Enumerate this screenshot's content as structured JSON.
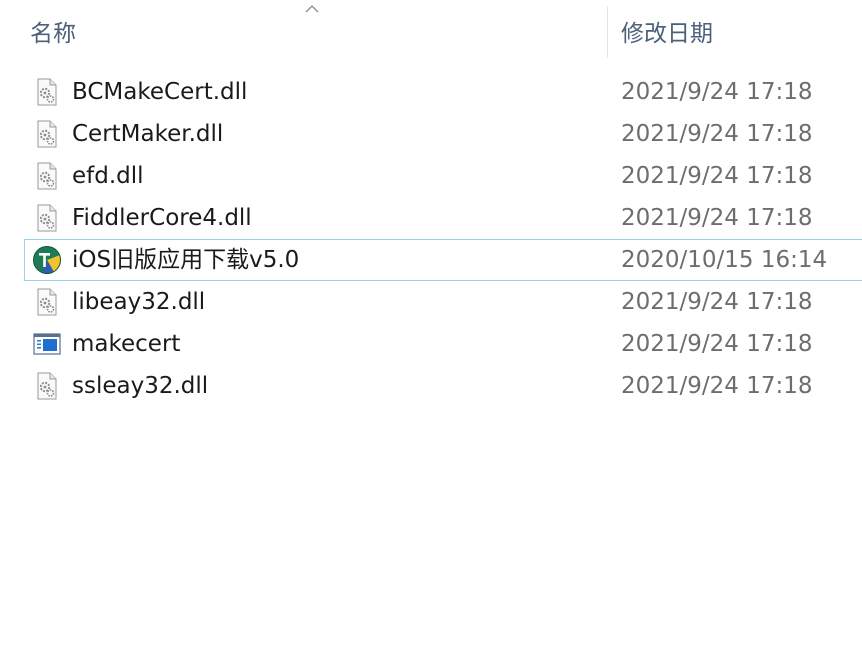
{
  "header": {
    "name_label": "名称",
    "date_label": "修改日期",
    "sort_icon": "chevron-up-icon"
  },
  "files": [
    {
      "name": "BCMakeCert.dll",
      "date": "2021/9/24 17:18",
      "icon": "dll-gear-icon"
    },
    {
      "name": "CertMaker.dll",
      "date": "2021/9/24 17:18",
      "icon": "dll-gear-icon"
    },
    {
      "name": "efd.dll",
      "date": "2021/9/24 17:18",
      "icon": "dll-gear-icon"
    },
    {
      "name": "FiddlerCore4.dll",
      "date": "2021/9/24 17:18",
      "icon": "dll-gear-icon"
    },
    {
      "name": "iOS旧版应用下载v5.0",
      "date": "2020/10/15 16:14",
      "icon": "app-logo-icon",
      "hovered": true
    },
    {
      "name": "libeay32.dll",
      "date": "2021/9/24 17:18",
      "icon": "dll-gear-icon"
    },
    {
      "name": "makecert",
      "date": "2021/9/24 17:18",
      "icon": "executable-window-icon"
    },
    {
      "name": "ssleay32.dll",
      "date": "2021/9/24 17:18",
      "icon": "dll-gear-icon"
    }
  ],
  "colors": {
    "header_text": "#4c607a",
    "name_text": "#1a1a1a",
    "date_text": "#6d6d6d",
    "hover_border": "#99d1ef"
  }
}
